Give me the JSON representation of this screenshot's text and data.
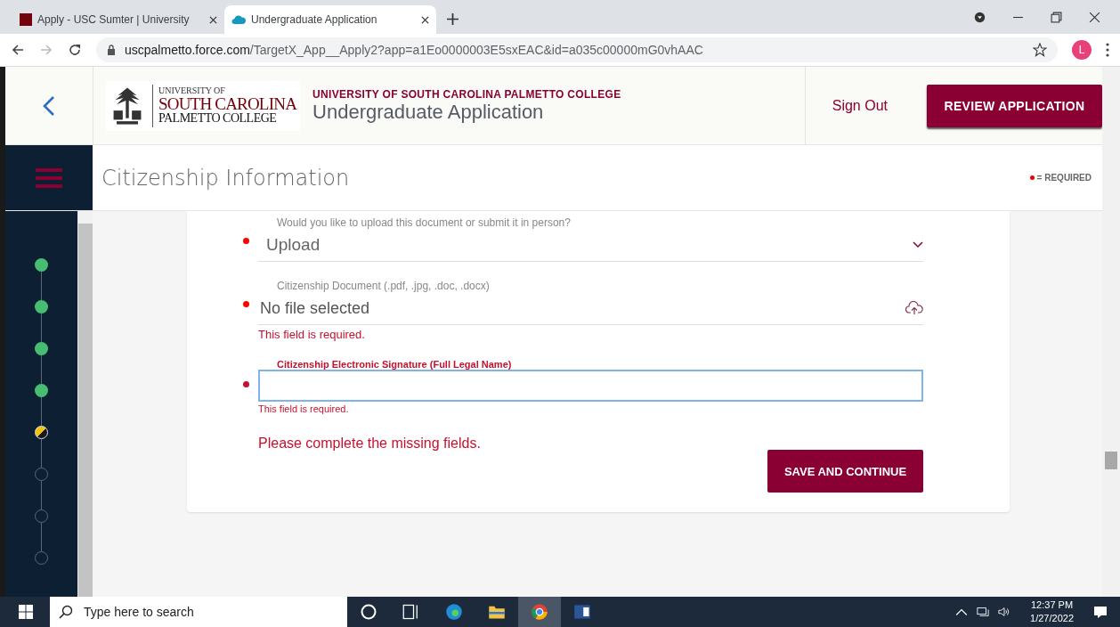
{
  "browser": {
    "tabs": [
      {
        "title": "Apply - USC Sumter | University",
        "selected": false,
        "kind": "usc"
      },
      {
        "title": "Undergraduate Application",
        "selected": true,
        "kind": "cloud"
      }
    ],
    "url": {
      "host": "uscpalmetto.force.com",
      "path": "/TargetX_App__Apply2?app=a1Eo0000003E5sxEAC&id=a035c00000mG0vhAAC"
    },
    "profile_initial": "L"
  },
  "header": {
    "logo": {
      "line_1": "UNIVERSITY OF",
      "line_2": "SOUTH CAROLINA",
      "line_3": "PALMETTO COLLEGE"
    },
    "org": "UNIVERSITY OF SOUTH CAROLINA PALMETTO COLLEGE",
    "title": "Undergraduate Application",
    "sign_out": "Sign Out",
    "review_button": "REVIEW APPLICATION"
  },
  "section": {
    "title": "Citizenship Information",
    "required_legend": "= REQUIRED"
  },
  "steps": [
    {
      "complete": true,
      "current": false
    },
    {
      "complete": true,
      "current": false
    },
    {
      "complete": true,
      "current": false
    },
    {
      "complete": true,
      "current": false
    },
    {
      "complete": false,
      "current": true
    },
    {
      "complete": false,
      "current": false
    },
    {
      "complete": false,
      "current": false
    },
    {
      "complete": false,
      "current": false
    }
  ],
  "fields": [
    {
      "kind": "select",
      "label": "Would you like to upload this document or submit it in person?",
      "value": "Upload",
      "required": true,
      "focused": false
    },
    {
      "kind": "file",
      "label": "Citizenship Document (.pdf, .jpg, .doc, .docx)",
      "value": "No file selected",
      "required": true,
      "focused": false,
      "error": "This field is required."
    },
    {
      "kind": "text",
      "label": "Citizenship Electronic Signature (Full Legal Name)",
      "required": true,
      "focused": true,
      "error": "This field is required."
    }
  ],
  "form_message": "Please complete the missing fields.",
  "save_button": "SAVE AND CONTINUE",
  "taskbar": {
    "search_placeholder": "Type here to search",
    "time": "12:37 PM",
    "date": "1/27/2022"
  }
}
